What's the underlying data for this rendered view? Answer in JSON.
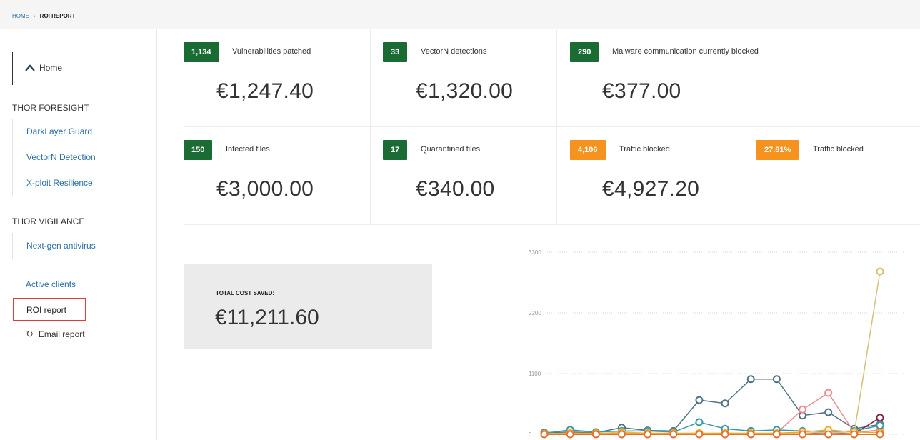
{
  "breadcrumb": {
    "home": "HOME",
    "separator": "›",
    "current": "ROI REPORT"
  },
  "sidebar": {
    "home_label": "Home",
    "foresight_title": "THOR FORESIGHT",
    "foresight_items": [
      {
        "label": "DarkLayer Guard"
      },
      {
        "label": "VectorN Detection"
      },
      {
        "label": "X-ploit Resilience"
      }
    ],
    "vigilance_title": "THOR VIGILANCE",
    "vigilance_items": [
      {
        "label": "Next-gen antivirus"
      }
    ],
    "active_clients": "Active clients",
    "roi_report": "ROI report",
    "email_report": "Email report",
    "email_icon": "↻"
  },
  "stats": [
    {
      "badge": "1,134",
      "label": "Vulnerabilities patched",
      "value": "€1,247.40",
      "color": "#1a6b34"
    },
    {
      "badge": "33",
      "label": "VectorN detections",
      "value": "€1,320.00",
      "color": "#1a6b34"
    },
    {
      "badge": "290",
      "label": "Malware communication currently blocked",
      "value": "€377.00",
      "color": "#1a6b34"
    },
    {
      "badge": "150",
      "label": "Infected files",
      "value": "€3,000.00",
      "color": "#1a6b34"
    },
    {
      "badge": "17",
      "label": "Quarantined files",
      "value": "€340.00",
      "color": "#1a6b34"
    },
    {
      "badge": "4,106",
      "label": "Traffic blocked",
      "value": "€4,927.20",
      "color": "#f6931e"
    },
    {
      "badge": "27.81%",
      "label": "Traffic blocked",
      "color": "#f6931e"
    }
  ],
  "total": {
    "label": "TOTAL COST SAVED:",
    "value": "€11,211.60"
  },
  "chart_data": {
    "type": "line",
    "y_ticks": [
      "3300",
      "2200",
      "1100",
      "0"
    ],
    "ylim": [
      0,
      3300
    ],
    "grid": true,
    "series": [
      {
        "color": "#4e7384",
        "values": [
          30,
          40,
          30,
          120,
          70,
          60,
          620,
          560,
          1000,
          1000,
          340,
          400,
          100,
          180
        ]
      },
      {
        "color": "#f08a8d",
        "values": [
          10,
          15,
          10,
          20,
          15,
          10,
          15,
          20,
          10,
          20,
          450,
          750,
          30,
          80
        ]
      },
      {
        "color": "#8b1f3f",
        "values": [
          5,
          10,
          5,
          10,
          10,
          5,
          10,
          10,
          5,
          10,
          10,
          10,
          10,
          300
        ]
      },
      {
        "color": "#3a9ba8",
        "values": [
          20,
          80,
          40,
          60,
          60,
          40,
          220,
          100,
          60,
          80,
          60,
          50,
          60,
          160
        ]
      },
      {
        "color": "#d6c07a",
        "values": [
          10,
          10,
          10,
          40,
          20,
          10,
          10,
          10,
          10,
          10,
          20,
          40,
          20,
          2950
        ]
      },
      {
        "color": "#f5a623",
        "values": [
          10,
          20,
          20,
          20,
          20,
          20,
          20,
          20,
          20,
          20,
          40,
          80,
          40,
          30
        ]
      },
      {
        "color": "#e8702a",
        "values": [
          0,
          0,
          0,
          0,
          0,
          0,
          0,
          0,
          0,
          0,
          0,
          0,
          0,
          0
        ]
      }
    ]
  }
}
